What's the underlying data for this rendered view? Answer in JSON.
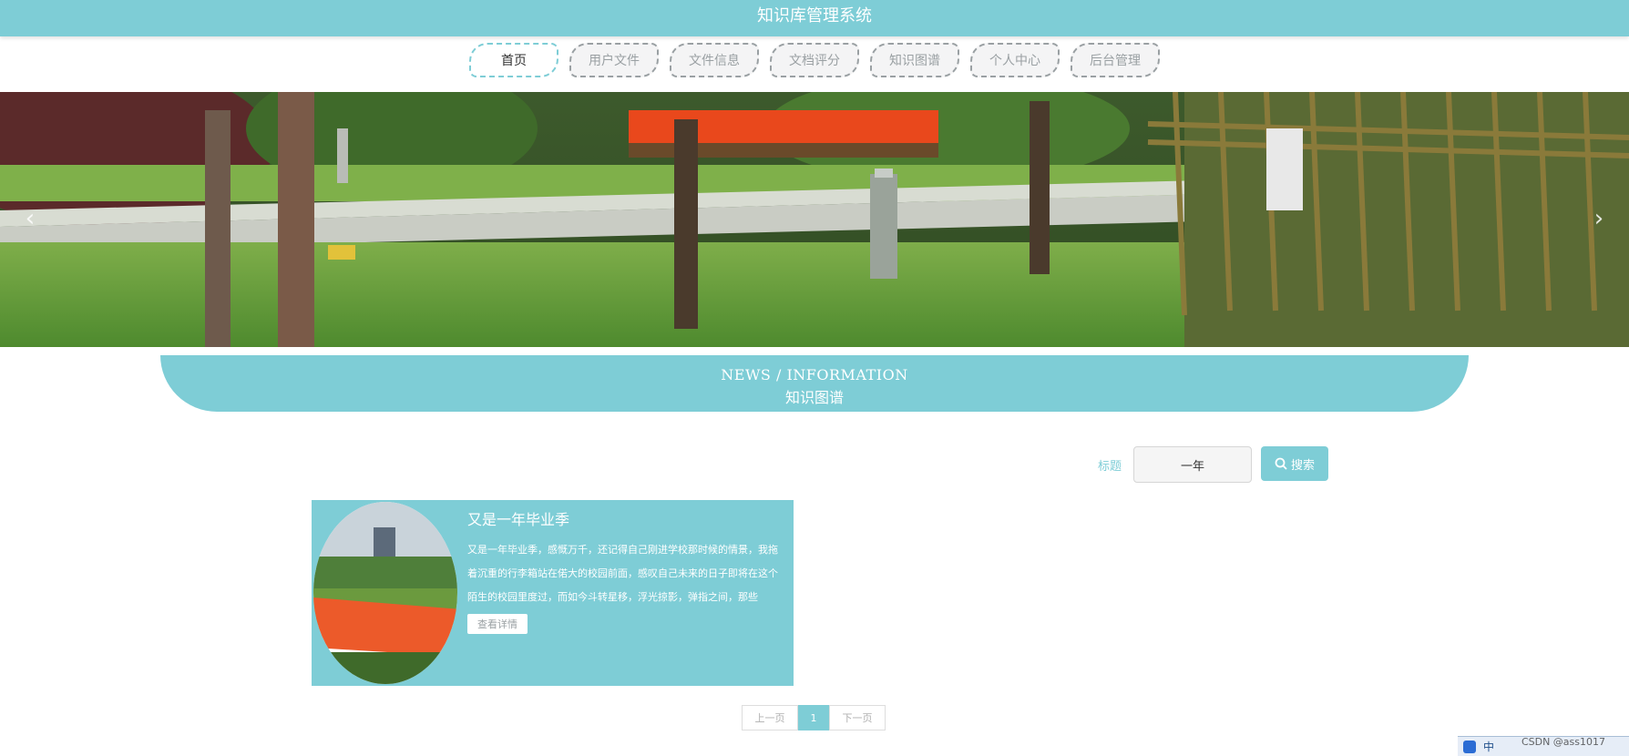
{
  "app": {
    "title": "知识库管理系统"
  },
  "nav": {
    "items": [
      {
        "label": "首页",
        "active": true
      },
      {
        "label": "用户文件",
        "active": false
      },
      {
        "label": "文件信息",
        "active": false
      },
      {
        "label": "文档评分",
        "active": false
      },
      {
        "label": "知识图谱",
        "active": false
      },
      {
        "label": "个人中心",
        "active": false
      },
      {
        "label": "后台管理",
        "active": false
      }
    ]
  },
  "banner": {
    "prev_icon": "chevron-left-icon",
    "next_icon": "chevron-right-icon"
  },
  "section": {
    "title_en": "NEWS / INFORMATION",
    "title_cn": "知识图谱"
  },
  "search": {
    "label": "标题",
    "value": "一年",
    "button_label": "搜索",
    "button_icon": "search-icon"
  },
  "items": [
    {
      "title": "又是一年毕业季",
      "summary": "又是一年毕业季，感慨万千，还记得自己刚进学校那时候的情景，我拖着沉重的行李箱站在偌大的校园前面，感叹自己未来的日子即将在这个陌生的校园里度过，而如今斗转星移，浮光掠影，弹指之间，那些",
      "button_label": "查看详情"
    }
  ],
  "pagination": {
    "prev_label": "上一页",
    "current": "1",
    "next_label": "下一页"
  },
  "tray": {
    "input_mode": "中"
  },
  "watermark": "CSDN @ass1017"
}
